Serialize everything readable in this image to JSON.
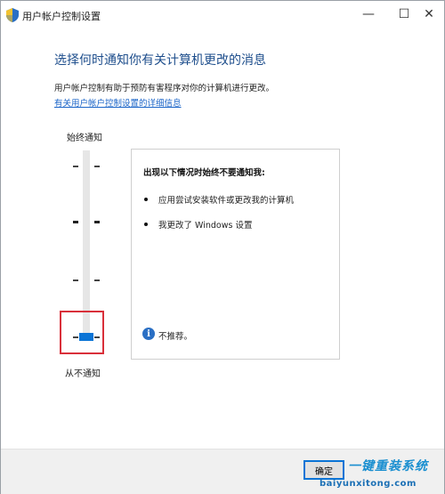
{
  "window": {
    "title": "用户帐户控制设置",
    "minimize_glyph": "—",
    "maximize_glyph": "☐",
    "close_glyph": "✕"
  },
  "main": {
    "heading": "选择何时通知你有关计算机更改的消息",
    "description": "用户帐户控制有助于预防有害程序对你的计算机进行更改。",
    "link": "有关用户帐户控制设置的详细信息"
  },
  "slider": {
    "top_label": "始终通知",
    "bottom_label": "从不通知",
    "levels": 4,
    "selected_level": 1
  },
  "panel": {
    "title": "出现以下情况时始终不要通知我:",
    "bullets": [
      "应用尝试安装软件或更改我的计算机",
      "我更改了 Windows 设置"
    ],
    "info": "不推荐。"
  },
  "footer": {
    "ok_label": "确定"
  },
  "watermark": {
    "text": "一键重装系统",
    "url": "baiyunxitong.com"
  },
  "colors": {
    "accent": "#0a74d6",
    "heading": "#1e4e8c",
    "highlight": "#d9303a"
  }
}
